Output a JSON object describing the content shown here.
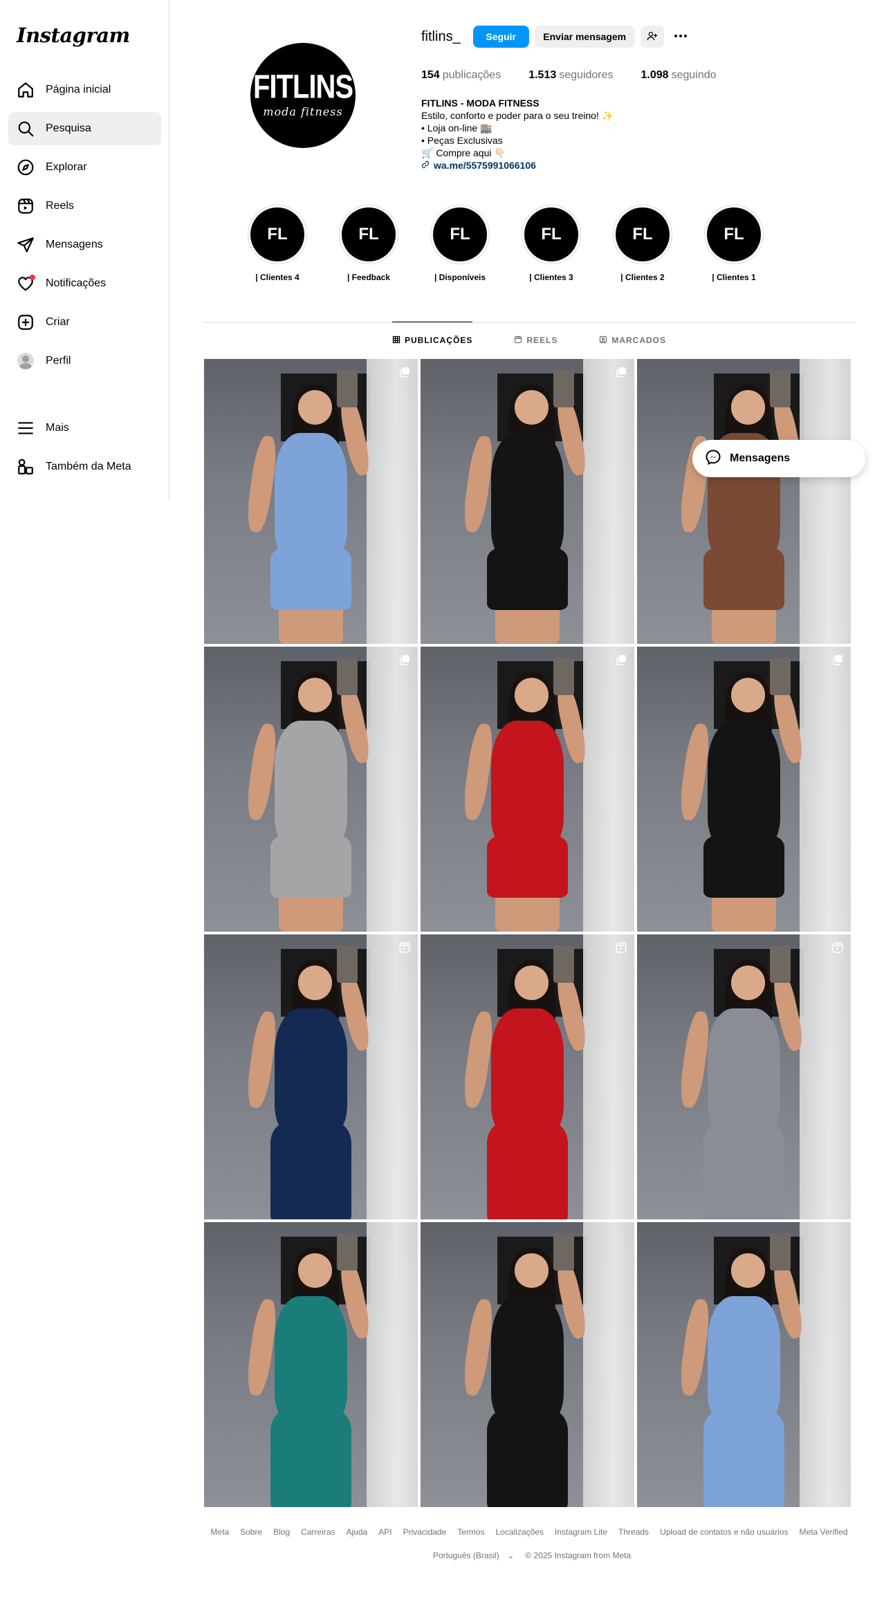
{
  "app": {
    "logo_text": "Instagram"
  },
  "sidebar": {
    "items": [
      {
        "label": "Página inicial",
        "icon": "home-icon"
      },
      {
        "label": "Pesquisa",
        "icon": "search-icon",
        "active": true
      },
      {
        "label": "Explorar",
        "icon": "compass-icon"
      },
      {
        "label": "Reels",
        "icon": "reels-icon"
      },
      {
        "label": "Mensagens",
        "icon": "send-icon"
      },
      {
        "label": "Notificações",
        "icon": "heart-icon",
        "has_dot": true
      },
      {
        "label": "Criar",
        "icon": "plus-square-icon"
      },
      {
        "label": "Perfil",
        "icon": "avatar"
      }
    ],
    "bottom_items": [
      {
        "label": "Mais",
        "icon": "menu-icon"
      },
      {
        "label": "Também da Meta",
        "icon": "meta-icon"
      }
    ]
  },
  "profile": {
    "pic_brand": "FITLINS",
    "pic_sub": "moda fitness",
    "username": "fitlins_",
    "follow_label": "Seguir",
    "message_label": "Enviar mensagem",
    "stats": {
      "posts_count": "154",
      "posts_label": "publicações",
      "followers_count": "1.513",
      "followers_label": "seguidores",
      "following_count": "1.098",
      "following_label": "seguindo"
    },
    "bio": {
      "name": "FITLINS - MODA FITNESS",
      "line1": "Estilo, conforto e poder para o seu treino! ✨",
      "line2": "• Loja on-line 🏬",
      "line3": "• Peças Exclusivas",
      "line4": "🛒 Compre aqui 👇🏻",
      "link": "wa.me/5575991066106"
    }
  },
  "highlights": [
    {
      "initials": "FL",
      "label": "| Clientes 4"
    },
    {
      "initials": "FL",
      "label": "| Feedback"
    },
    {
      "initials": "FL",
      "label": "| Disponíveis"
    },
    {
      "initials": "FL",
      "label": "| Clientes 3"
    },
    {
      "initials": "FL",
      "label": "| Clientes 2"
    },
    {
      "initials": "FL",
      "label": "| Clientes 1"
    }
  ],
  "tabs": [
    {
      "label": "PUBLICAÇÕES",
      "icon": "grid-icon",
      "active": true
    },
    {
      "label": "REELS",
      "icon": "reels-icon"
    },
    {
      "label": "MARCADOS",
      "icon": "tagged-icon"
    }
  ],
  "posts": [
    {
      "outfit": "#7da3d8",
      "mark": "carousel-icon"
    },
    {
      "outfit": "#141414",
      "mark": "carousel-icon"
    },
    {
      "outfit": "#7a4a35",
      "mark": ""
    },
    {
      "outfit": "#a5a5a8",
      "mark": "carousel-icon"
    },
    {
      "outfit": "#c4141e",
      "mark": "carousel-icon"
    },
    {
      "outfit": "#141414",
      "mark": "carousel-icon"
    },
    {
      "outfit": "#152a52",
      "mark": "reel-icon"
    },
    {
      "outfit": "#c4141e",
      "mark": "reel-icon"
    },
    {
      "outfit": "#8a8d95",
      "mark": "reel-icon"
    },
    {
      "outfit": "#1a7d7a",
      "mark": ""
    },
    {
      "outfit": "#141414",
      "mark": ""
    },
    {
      "outfit": "#7da3d8",
      "mark": ""
    }
  ],
  "floating": {
    "label": "Mensagens"
  },
  "footer": {
    "links": [
      "Meta",
      "Sobre",
      "Blog",
      "Carreiras",
      "Ajuda",
      "API",
      "Privacidade",
      "Termos",
      "Localizações",
      "Instagram Lite",
      "Threads",
      "Upload de contatos e não usuários",
      "Meta Verified"
    ],
    "language": "Português (Brasil)",
    "copyright": "© 2025 Instagram from Meta"
  },
  "colors": {
    "accent": "#0095f6",
    "link": "#00376b",
    "notification_dot": "#ff3040"
  }
}
